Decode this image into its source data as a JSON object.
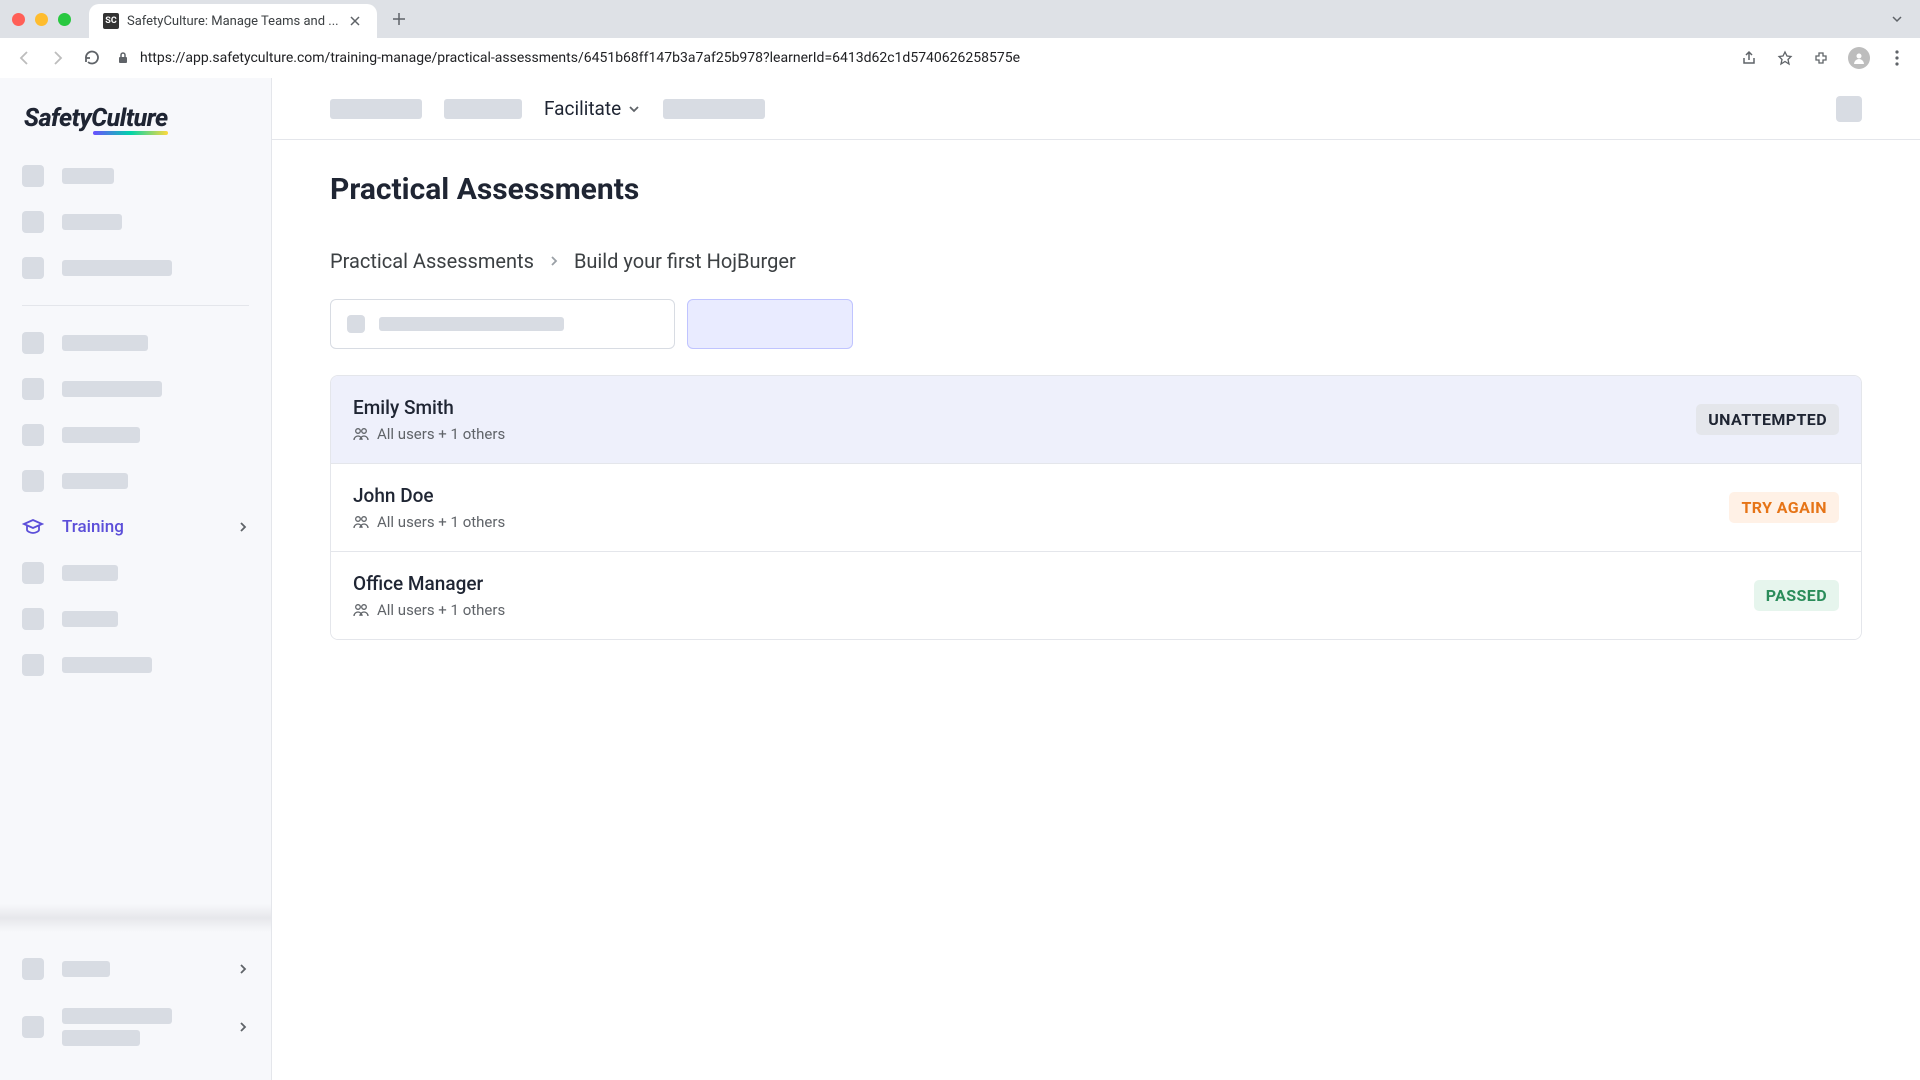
{
  "browser": {
    "tab_title": "SafetyCulture: Manage Teams and ...",
    "url": "https://app.safetyculture.com/training-manage/practical-assessments/6451b68ff147b3a7af25b978?learnerId=6413d62c1d5740626258575e"
  },
  "sidebar": {
    "logo_text": "SafetyCulture",
    "training_label": "Training"
  },
  "topbar": {
    "dropdown_label": "Facilitate"
  },
  "page": {
    "title": "Practical Assessments",
    "breadcrumb_root": "Practical Assessments",
    "breadcrumb_current": "Build your first HojBurger"
  },
  "results": [
    {
      "name": "Emily Smith",
      "subtitle": "All users + 1 others",
      "status_label": "UNATTEMPTED",
      "status_class": "status-unattempted",
      "selected": true
    },
    {
      "name": "John Doe",
      "subtitle": "All users + 1 others",
      "status_label": "TRY AGAIN",
      "status_class": "status-tryagain",
      "selected": false
    },
    {
      "name": "Office Manager",
      "subtitle": "All users + 1 others",
      "status_label": "PASSED",
      "status_class": "status-passed",
      "selected": false
    }
  ]
}
